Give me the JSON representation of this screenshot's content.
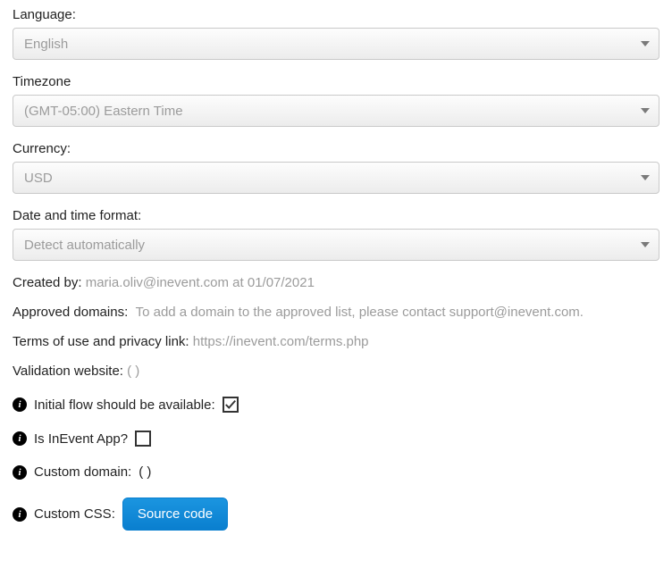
{
  "fields": {
    "language": {
      "label": "Language:",
      "value": "English"
    },
    "timezone": {
      "label": "Timezone",
      "value": "(GMT-05:00) Eastern Time"
    },
    "currency": {
      "label": "Currency:",
      "value": "USD"
    },
    "datetimeFormat": {
      "label": "Date and time format:",
      "value": "Detect automatically"
    }
  },
  "createdBy": {
    "label": "Created by:",
    "value": "maria.oliv@inevent.com at 01/07/2021"
  },
  "approvedDomains": {
    "label": "Approved domains:",
    "value": "To add a domain to the approved list, please contact support@inevent.com."
  },
  "termsLink": {
    "label": "Terms of use and privacy link:",
    "value": "https://inevent.com/terms.php"
  },
  "validationWebsite": {
    "label": "Validation website:",
    "value": "( )"
  },
  "initialFlow": {
    "label": "Initial flow should be available:",
    "checked": true
  },
  "isInEventApp": {
    "label": "Is InEvent App?",
    "checked": false
  },
  "customDomain": {
    "label": "Custom domain:",
    "value": "( )"
  },
  "customCSS": {
    "label": "Custom CSS:",
    "button": "Source code"
  }
}
